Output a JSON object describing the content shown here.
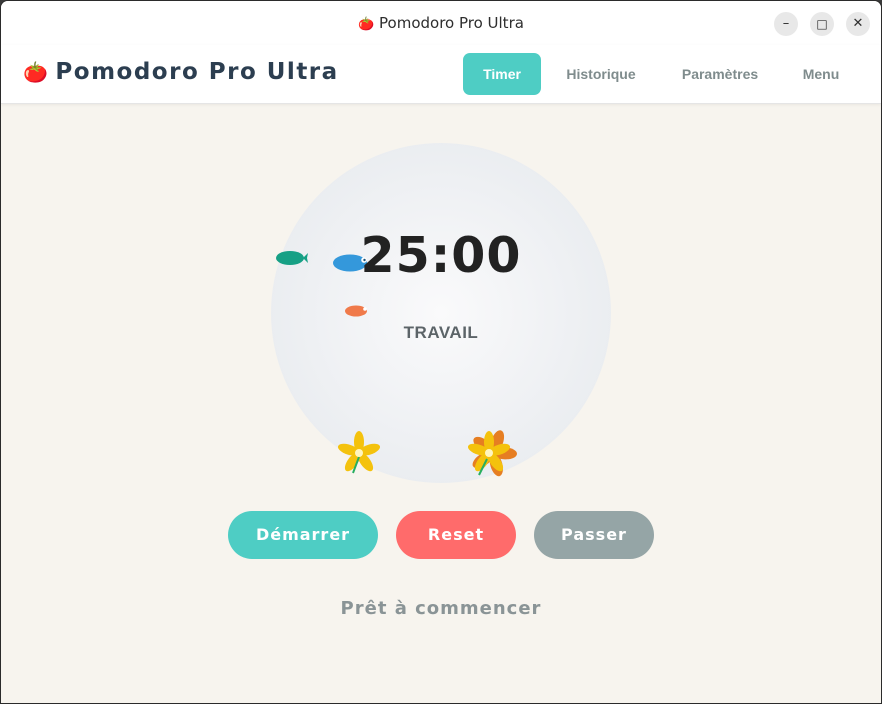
{
  "window": {
    "title_icon": "🍅",
    "title": "Pomodoro Pro Ultra",
    "controls": {
      "minimize": "–",
      "maximize": "□",
      "close": "✕"
    }
  },
  "header": {
    "logo_icon": "🍅",
    "app_name": "Pomodoro Pro Ultra",
    "nav": [
      {
        "label": "Timer",
        "active": true
      },
      {
        "label": "Historique",
        "active": false
      },
      {
        "label": "Paramètres",
        "active": false
      },
      {
        "label": "Menu",
        "active": false
      }
    ]
  },
  "timer": {
    "time": "25:00",
    "mode": "TRAVAIL"
  },
  "buttons": {
    "start": "Démarrer",
    "reset": "Reset",
    "skip": "Passer"
  },
  "status": "Prêt à commencer",
  "colors": {
    "accent": "#4ecdc4",
    "reset": "#ff6b6b",
    "skip": "#95a5a6",
    "background": "#f7f4ee",
    "text_dark": "#2c3e50"
  },
  "decorations": {
    "fish": [
      "teal",
      "blue",
      "orange"
    ],
    "flowers": [
      "yellow-flower",
      "yellow-flower",
      "orange-flower"
    ]
  }
}
